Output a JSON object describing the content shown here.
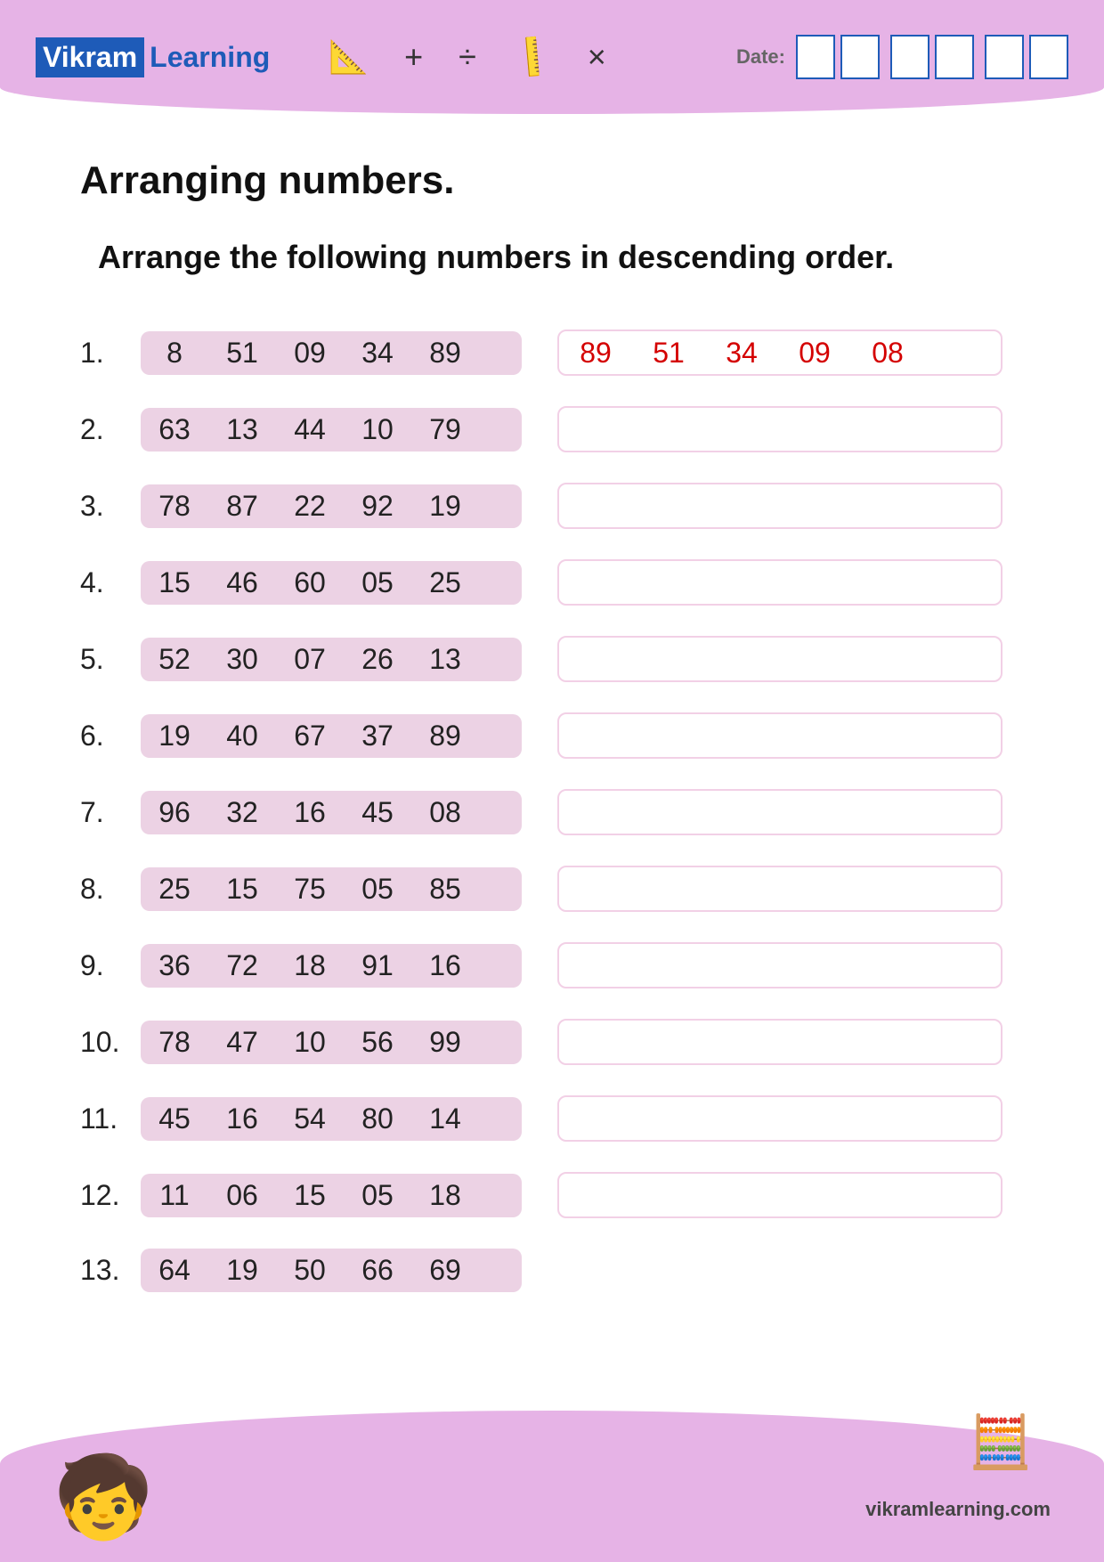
{
  "header": {
    "logo_part1": "Vikram",
    "logo_part2": "Learning",
    "symbols": {
      "plus": "+",
      "divide": "÷",
      "times": "×"
    },
    "date_label": "Date:"
  },
  "title": "Arranging numbers.",
  "subtitle": "Arrange the following numbers in descending order.",
  "rows": [
    {
      "n": "1.",
      "nums": [
        "8",
        "51",
        "09",
        "34",
        "89"
      ],
      "answer": [
        "89",
        "51",
        "34",
        "09",
        "08"
      ]
    },
    {
      "n": "2.",
      "nums": [
        "63",
        "13",
        "44",
        "10",
        "79"
      ],
      "answer": []
    },
    {
      "n": "3.",
      "nums": [
        "78",
        "87",
        "22",
        "92",
        "19"
      ],
      "answer": []
    },
    {
      "n": "4.",
      "nums": [
        "15",
        "46",
        "60",
        "05",
        "25"
      ],
      "answer": []
    },
    {
      "n": "5.",
      "nums": [
        "52",
        "30",
        "07",
        "26",
        "13"
      ],
      "answer": []
    },
    {
      "n": "6.",
      "nums": [
        "19",
        "40",
        "67",
        "37",
        "89"
      ],
      "answer": []
    },
    {
      "n": "7.",
      "nums": [
        "96",
        "32",
        "16",
        "45",
        "08"
      ],
      "answer": []
    },
    {
      "n": "8.",
      "nums": [
        "25",
        "15",
        "75",
        "05",
        "85"
      ],
      "answer": []
    },
    {
      "n": "9.",
      "nums": [
        "36",
        "72",
        "18",
        "91",
        "16"
      ],
      "answer": []
    },
    {
      "n": "10.",
      "nums": [
        "78",
        "47",
        "10",
        "56",
        "99"
      ],
      "answer": []
    },
    {
      "n": "11.",
      "nums": [
        "45",
        "16",
        "54",
        "80",
        "14"
      ],
      "answer": []
    },
    {
      "n": "12.",
      "nums": [
        "11",
        "06",
        "15",
        "05",
        "18"
      ],
      "answer": []
    },
    {
      "n": "13.",
      "nums": [
        "64",
        "19",
        "50",
        "66",
        "69"
      ],
      "answer": null
    }
  ],
  "footer": {
    "url": "vikramlearning.com"
  }
}
